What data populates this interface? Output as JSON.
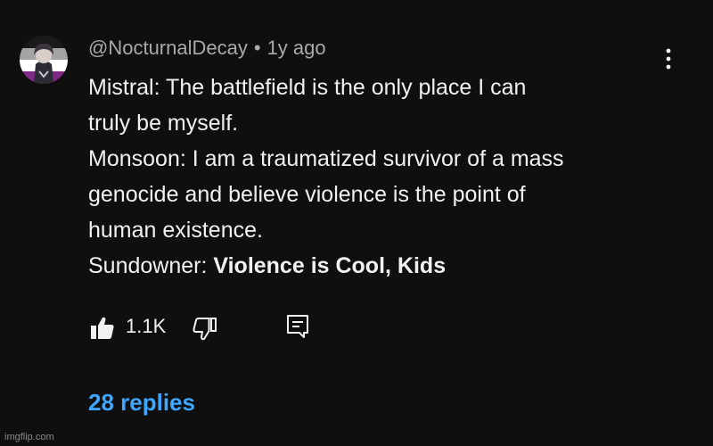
{
  "comment": {
    "author": "@NocturnalDecay",
    "separator": "•",
    "timestamp": "1y ago",
    "lines": [
      "Mistral: The battlefield is the only place I can",
      "truly be myself.",
      "Monsoon: I am a traumatized survivor of a mass",
      "genocide and believe violence is the point of",
      "human existence."
    ],
    "last_line_prefix": "Sundowner: ",
    "last_line_bold": "Violence is Cool, Kids"
  },
  "actions": {
    "like_count": "1.1K",
    "like_icon": "thumbs-up-icon",
    "dislike_icon": "thumbs-down-icon",
    "reply_icon": "reply-icon",
    "more_icon": "more-vertical-icon"
  },
  "replies_label": "28 replies",
  "watermark": "imgflip.com",
  "colors": {
    "background": "#0f0f0f",
    "text_primary": "#f1f1f1",
    "text_secondary": "#aaaaaa",
    "link": "#3ea6ff"
  }
}
